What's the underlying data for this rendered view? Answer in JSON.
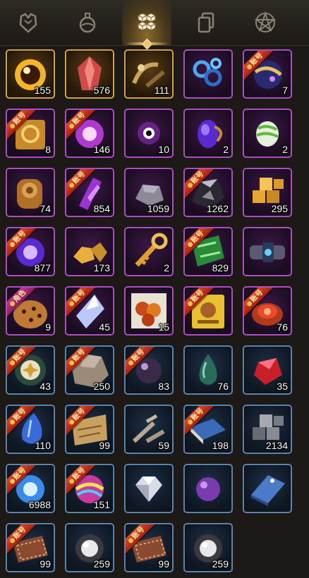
{
  "tabs": [
    {
      "name": "armor",
      "icon": "armor-icon"
    },
    {
      "name": "potion",
      "icon": "potion-icon"
    },
    {
      "name": "materials",
      "icon": "cubes-icon",
      "active": true
    },
    {
      "name": "cards",
      "icon": "cards-icon"
    },
    {
      "name": "pentagram",
      "icon": "pentagram-icon"
    }
  ],
  "colors": {
    "gold": "#d8a53c",
    "purple": "#b24cc9",
    "blue": "#5a86b4",
    "ribbon": "#c02c16"
  },
  "items": [
    {
      "icon": "golden-orb",
      "rarity": "gold",
      "count": "155",
      "tag": ""
    },
    {
      "icon": "red-crystal",
      "rarity": "gold",
      "count": "576",
      "tag": ""
    },
    {
      "icon": "bronze-fragments",
      "rarity": "gold",
      "count": "111",
      "tag": ""
    },
    {
      "icon": "blue-chain",
      "rarity": "purple",
      "count": "",
      "tag": ""
    },
    {
      "icon": "starry-orb",
      "rarity": "purple",
      "count": "7",
      "tag": "账号"
    },
    {
      "icon": "gold-scroll",
      "rarity": "purple",
      "count": "8",
      "tag": "账号"
    },
    {
      "icon": "purple-orb",
      "rarity": "purple",
      "count": "146",
      "tag": "账号"
    },
    {
      "icon": "void-spark",
      "rarity": "purple",
      "count": "10",
      "tag": ""
    },
    {
      "icon": "amethyst-egg",
      "rarity": "purple",
      "count": "2",
      "tag": ""
    },
    {
      "icon": "striped-egg",
      "rarity": "purple",
      "count": "2",
      "tag": ""
    },
    {
      "icon": "bronze-seal",
      "rarity": "purple",
      "count": "74",
      "tag": ""
    },
    {
      "icon": "purple-shard",
      "rarity": "purple",
      "count": "854",
      "tag": "账号"
    },
    {
      "icon": "grey-stone",
      "rarity": "purple",
      "count": "1059",
      "tag": ""
    },
    {
      "icon": "dark-ore",
      "rarity": "purple",
      "count": "1262",
      "tag": "账号"
    },
    {
      "icon": "gold-cubes",
      "rarity": "purple",
      "count": "295",
      "tag": ""
    },
    {
      "icon": "violet-orb",
      "rarity": "purple",
      "count": "877",
      "tag": "账号"
    },
    {
      "icon": "gold-nuggets",
      "rarity": "purple",
      "count": "173",
      "tag": ""
    },
    {
      "icon": "golden-key",
      "rarity": "purple",
      "count": "2",
      "tag": ""
    },
    {
      "icon": "green-cloth",
      "rarity": "purple",
      "count": "829",
      "tag": "账号"
    },
    {
      "icon": "gem-bracer",
      "rarity": "purple",
      "count": "",
      "tag": ""
    },
    {
      "icon": "cookie",
      "rarity": "purple",
      "count": "9",
      "tag": "角色"
    },
    {
      "icon": "ice-crystal",
      "rarity": "purple",
      "count": "45",
      "tag": "账号"
    },
    {
      "icon": "amber-cluster",
      "rarity": "purple",
      "count": "15",
      "tag": ""
    },
    {
      "icon": "hero-card",
      "rarity": "purple",
      "count": "",
      "tag": "账号"
    },
    {
      "icon": "ruby-ring",
      "rarity": "purple",
      "count": "76",
      "tag": "账号"
    },
    {
      "icon": "sun-medal",
      "rarity": "blue",
      "count": "43",
      "tag": "账号"
    },
    {
      "icon": "rough-stone",
      "rarity": "blue",
      "count": "250",
      "tag": "账号"
    },
    {
      "icon": "dark-pearl",
      "rarity": "blue",
      "count": "83",
      "tag": "账号"
    },
    {
      "icon": "jade-drop",
      "rarity": "blue",
      "count": "76",
      "tag": ""
    },
    {
      "icon": "red-gem",
      "rarity": "blue",
      "count": "35",
      "tag": ""
    },
    {
      "icon": "sapphire-drop",
      "rarity": "blue",
      "count": "110",
      "tag": "账号"
    },
    {
      "icon": "old-map",
      "rarity": "blue",
      "count": "99",
      "tag": "账号"
    },
    {
      "icon": "wood-sticks",
      "rarity": "blue",
      "count": "59",
      "tag": ""
    },
    {
      "icon": "blue-book",
      "rarity": "blue",
      "count": "198",
      "tag": "账号"
    },
    {
      "icon": "steel-cubes",
      "rarity": "blue",
      "count": "2134",
      "tag": ""
    },
    {
      "icon": "azure-orb",
      "rarity": "blue",
      "count": "6988",
      "tag": "账号"
    },
    {
      "icon": "prism-orb",
      "rarity": "blue",
      "count": "151",
      "tag": "账号"
    },
    {
      "icon": "diamond",
      "rarity": "blue",
      "count": "",
      "tag": ""
    },
    {
      "icon": "violet-bead",
      "rarity": "blue",
      "count": "",
      "tag": ""
    },
    {
      "icon": "blue-ingot",
      "rarity": "blue",
      "count": "",
      "tag": ""
    },
    {
      "icon": "leather-patch",
      "rarity": "blue",
      "count": "99",
      "tag": "账号"
    },
    {
      "icon": "silver-orb",
      "rarity": "blue",
      "count": "259",
      "tag": ""
    },
    {
      "icon": "leather-patch",
      "rarity": "blue",
      "count": "99",
      "tag": "账号"
    },
    {
      "icon": "silver-orb",
      "rarity": "blue",
      "count": "259",
      "tag": ""
    }
  ]
}
